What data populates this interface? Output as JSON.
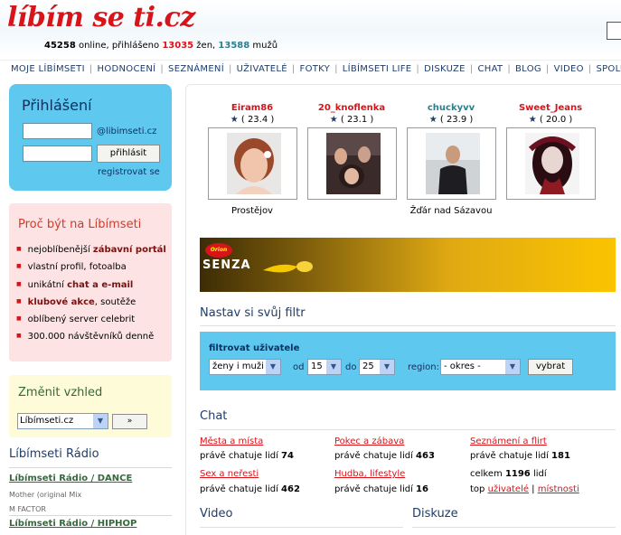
{
  "header": {
    "logo": "líbím se ti.cz",
    "online_count": "45258",
    "online_text": " online, přihlášeno ",
    "women_count": "13035",
    "women_text": " žen, ",
    "men_count": "13588",
    "men_text": " mužů"
  },
  "nav": [
    "MOJE LÍBÍMSETI",
    "HODNOCENÍ",
    "SEZNÁMENÍ",
    "UŽIVATELÉ",
    "FOTKY",
    "LÍBÍMSETI LIFE",
    "DISKUZE",
    "CHAT",
    "BLOG",
    "VIDEO",
    "SPOLU"
  ],
  "login": {
    "title": "Přihlášení",
    "username_value": "",
    "password_value": "",
    "domain_label": "@libimseti.cz",
    "submit_label": "přihlásit",
    "register_link": "registrovat se"
  },
  "why": {
    "title": "Proč být na Líbímseti",
    "items": [
      {
        "pre": "nejoblíbenější ",
        "bold": "zábavní portál",
        "post": ""
      },
      {
        "pre": "vlastní profil, fotoalba",
        "bold": "",
        "post": ""
      },
      {
        "pre": "unikátní ",
        "bold": "chat a e-mail",
        "post": ""
      },
      {
        "pre": "",
        "bold": "klubové akce",
        "post": ", soutěže"
      },
      {
        "pre": "oblíbený server celebrit",
        "bold": "",
        "post": ""
      },
      {
        "pre": "300.000 návštěvníků denně",
        "bold": "",
        "post": ""
      }
    ]
  },
  "skin": {
    "title": "Změnit vzhled",
    "selected": "Líbímseti.cz",
    "go_label": "»"
  },
  "radio": {
    "title": "Líbímseti Rádio",
    "stations": [
      {
        "name": "Líbímseti Rádio / DANCE",
        "now_playing": "Mother (original Mix",
        "artist": "M FACTOR"
      },
      {
        "name": "Líbímseti Rádio / HIPHOP"
      }
    ]
  },
  "users": [
    {
      "name": "Eiram86",
      "score": "( 23.4 )",
      "city": "Prostějov",
      "name_color": "red"
    },
    {
      "name": "20_knoflenka",
      "score": "( 23.1 )",
      "city": "",
      "name_color": "red"
    },
    {
      "name": "chuckyvv",
      "score": "( 23.9 )",
      "city": "Žďár nad Sázavou",
      "name_color": "teal"
    },
    {
      "name": "Sweet_Jeans",
      "score": "( 20.0 )",
      "city": "",
      "name_color": "red"
    }
  ],
  "banner": {
    "brand": "SENZA",
    "badge": "Orion"
  },
  "filter": {
    "title": "Nastav si svůj filtr",
    "label": "filtrovat uživatele",
    "gender": "ženy i muži",
    "from_label": "od",
    "from_value": "15",
    "to_label": "do",
    "to_value": "25",
    "region_label": "region:",
    "region_value": "- okres -",
    "submit_label": "vybrat"
  },
  "chat": {
    "title": "Chat",
    "prefix": "právě chatuje lidí ",
    "rooms": [
      {
        "name": "Města a místa",
        "count": "74"
      },
      {
        "name": "Pokec a zábava",
        "count": "463"
      },
      {
        "name": "Seznámení a flirt",
        "count": "181"
      },
      {
        "name": "Sex a neřesti",
        "count": "462"
      },
      {
        "name": "Hudba, lifestyle",
        "count": "16"
      }
    ],
    "total_pre": "celkem ",
    "total_count": "1196",
    "total_post": " lidí",
    "top_pre": "top ",
    "top_users": "uživatelé",
    "top_sep": " | ",
    "top_rooms": "místnosti"
  },
  "sections": {
    "video": "Video",
    "discussion": "Diskuze"
  }
}
